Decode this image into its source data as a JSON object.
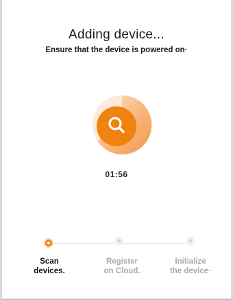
{
  "header": {
    "title": "Adding device...",
    "subtitle": "Ensure that the device is powered on·"
  },
  "scan": {
    "icon": "search-icon",
    "timer": "01:56",
    "accent_color": "#f0820f"
  },
  "steps": [
    {
      "label": "Scan\ndevices.",
      "state": "active"
    },
    {
      "label": "Register\non Cloud.",
      "state": "pending"
    },
    {
      "label": "Initialize\nthe device·",
      "state": "pending"
    }
  ]
}
